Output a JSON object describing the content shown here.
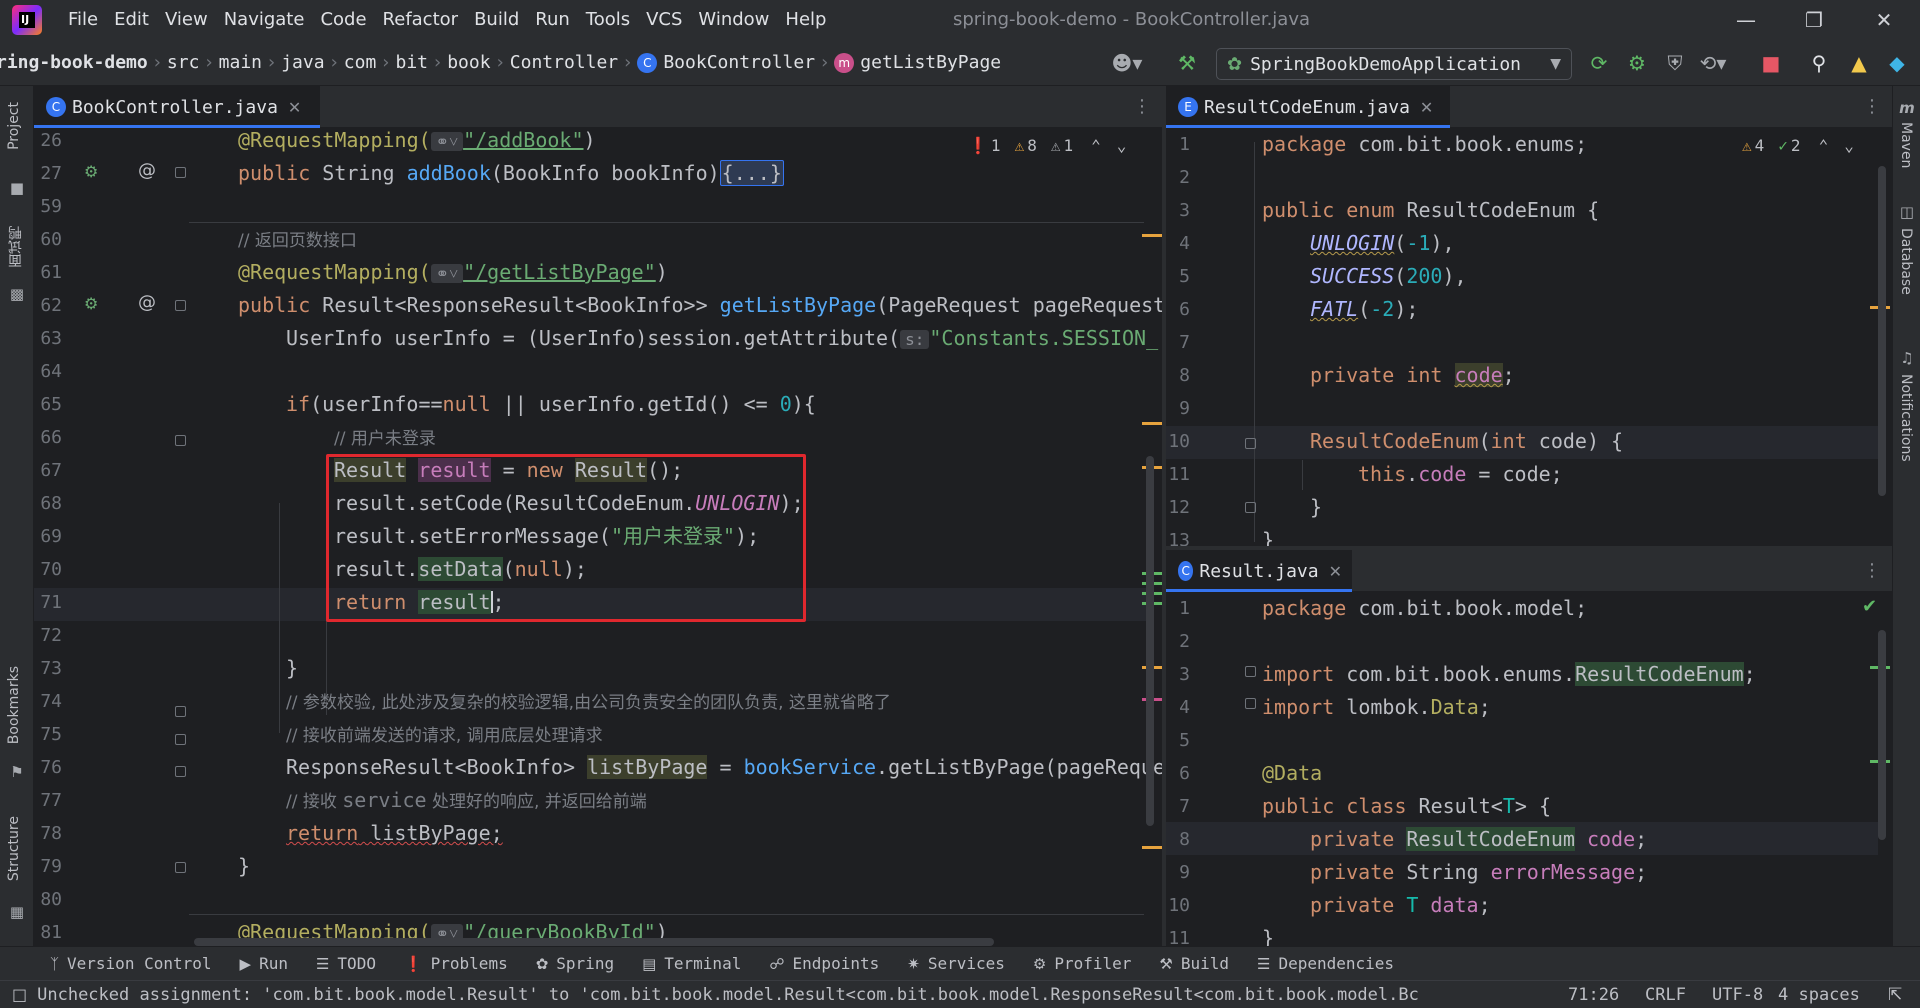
{
  "menubar": {
    "items": [
      "File",
      "Edit",
      "View",
      "Navigate",
      "Code",
      "Refactor",
      "Build",
      "Run",
      "Tools",
      "VCS",
      "Window",
      "Help"
    ],
    "window_title": "spring-book-demo - BookController.java"
  },
  "navbar": {
    "crumbs": [
      "ring-book-demo",
      "src",
      "main",
      "java",
      "com",
      "bit",
      "book",
      "Controller",
      "BookController",
      "getListByPage"
    ],
    "run_config": "SpringBookDemoApplication"
  },
  "left_stripe": {
    "project_label": "Project",
    "favorites_label": "面试鸭",
    "bookmarks_label": "Bookmarks",
    "structure_label": "Structure"
  },
  "right_stripe": {
    "maven_label": "Maven",
    "database_label": "Database",
    "notifications_label": "Notifications"
  },
  "left_editor": {
    "tab": "BookController.java",
    "inspections": {
      "errors": "1",
      "warnings": "8",
      "weak_warnings": "1"
    },
    "line_numbers": [
      "26",
      "27",
      "59",
      "60",
      "61",
      "62",
      "63",
      "64",
      "65",
      "66",
      "67",
      "68",
      "69",
      "70",
      "71",
      "72",
      "73",
      "74",
      "75",
      "76",
      "77",
      "78",
      "79",
      "80",
      "81"
    ],
    "lines": {
      "l26_ann": "@RequestMapping(",
      "l26_path": "\"/addBook\"",
      "l26_end": ")",
      "l27_pub": "public ",
      "l27_type": "String ",
      "l27_fn": "addBook",
      "l27_args": "(BookInfo bookInfo)",
      "l27_fold": "{...}",
      "l60": "// 返回页数接口",
      "l61_ann": "@RequestMapping(",
      "l61_path": "\"/getListByPage\"",
      "l61_end": ")",
      "l62_pub": "public ",
      "l62_type": "Result<ResponseResult<BookInfo>> ",
      "l62_fn": "getListByPage",
      "l62_args": "(PageRequest pageRequest",
      "l63_a": "UserInfo userInfo = (UserInfo)session.getAttribute(",
      "l63_hint": "s:",
      "l63_str": "\"Constants.SESSION_",
      "l65_if": "if",
      "l65_a": "(userInfo==",
      "l65_null": "null",
      "l65_b": " || userInfo.getId() <= ",
      "l65_num": "0",
      "l65_c": "){",
      "l66": "// 用户未登录",
      "l67_t1": "Result",
      "l67_v": "result",
      "l67_eq": " = ",
      "l67_new": "new ",
      "l67_t2": "Result",
      "l67_end": "();",
      "l68_a": "result.setCode(ResultCodeEnum.",
      "l68_const": "UNLOGIN",
      "l68_end": ");",
      "l69_a": "result.setErrorMessage(",
      "l69_str": "\"用户未登录\"",
      "l69_end": ");",
      "l70_a": "result.",
      "l70_fn": "setData",
      "l70_b": "(",
      "l70_null": "null",
      "l70_end": ");",
      "l71_ret": "return ",
      "l71_v": "result",
      "l71_end": ";",
      "l73": "}",
      "l74": "// 参数校验, 此处涉及复杂的校验逻辑,由公司负责安全的团队负责, 这里就省略了",
      "l75": "// 接收前端发送的请求, 调用底层处理请求",
      "l76_a": "ResponseResult<BookInfo> ",
      "l76_v": "listByPage",
      "l76_eq": " = ",
      "l76_svc": "bookService",
      "l76_b": ".getListByPage(pageReque",
      "l77_a": "// 接收 ",
      "l77_b": "service",
      "l77_c": " 处理好的响应, 并返回给前端",
      "l78_ret": "return",
      "l78_b": " listByPage;",
      "l79": "}",
      "l81_ann": "@RequestMapping(",
      "l81_path": "\"/queryBookById\"",
      "l81_end": ")"
    }
  },
  "right_top_editor": {
    "tab": "ResultCodeEnum.java",
    "inspections": {
      "warnings": "4",
      "typos": "2"
    },
    "line_numbers": [
      "1",
      "2",
      "3",
      "4",
      "5",
      "6",
      "7",
      "8",
      "9",
      "10",
      "11",
      "12",
      "13"
    ],
    "lines": {
      "l1_kw": "package ",
      "l1_b": "com.bit.book.enums;",
      "l3_kw": "public enum ",
      "l3_b": "ResultCodeEnum {",
      "l4_c": "UNLOGIN",
      "l4_a": "(",
      "l4_n": "-1",
      "l4_e": "),",
      "l5_c": "SUCCESS",
      "l5_a": "(",
      "l5_n": "200",
      "l5_e": "),",
      "l6_c": "FATL",
      "l6_a": "(",
      "l6_n": "-2",
      "l6_e": ");",
      "l8_kw": "private int ",
      "l8_f": "code",
      "l8_e": ";",
      "l10_fn": "ResultCodeEnum",
      "l10_a": "(",
      "l10_kw": "int ",
      "l10_b": "code) {",
      "l11_kw": "this",
      "l11_a": ".",
      "l11_f": "code",
      "l11_b": " = code;",
      "l12": "}",
      "l13": "}"
    }
  },
  "right_bottom_editor": {
    "tab": "Result.java",
    "line_numbers": [
      "1",
      "2",
      "3",
      "4",
      "5",
      "6",
      "7",
      "8",
      "9",
      "10",
      "11"
    ],
    "lines": {
      "l1_kw": "package ",
      "l1_b": "com.bit.book.model;",
      "l3_kw": "import ",
      "l3_b": "com.bit.book.enums.",
      "l3_c": "ResultCodeEnum",
      "l3_e": ";",
      "l4_kw": "import ",
      "l4_b": "lombok.",
      "l4_c": "Data",
      "l4_e": ";",
      "l6": "@Data",
      "l7_kw": "public class ",
      "l7_b": "Result<",
      "l7_t": "T",
      "l7_e": "> {",
      "l8_kw": "private ",
      "l8_t": "ResultCodeEnum",
      "l8_f": " code",
      "l8_e": ";",
      "l9_kw": "private ",
      "l9_t": "String ",
      "l9_f": "errorMessage",
      "l9_e": ";",
      "l10_kw": "private ",
      "l10_t": "T ",
      "l10_f": "data",
      "l10_e": ";",
      "l11": "}"
    }
  },
  "toolwindows": [
    "Version Control",
    "Run",
    "TODO",
    "Problems",
    "Spring",
    "Terminal",
    "Endpoints",
    "Services",
    "Profiler",
    "Build",
    "Dependencies"
  ],
  "statusbar": {
    "message": "Unchecked assignment: 'com.bit.book.model.Result' to 'com.bit.book.model.Result<com.bit.book.model.ResponseResult<com.bit.book.model.Bc",
    "position": "71:26",
    "line_sep": "CRLF",
    "encoding": "UTF-8",
    "indent": "4 spaces"
  },
  "colors": {
    "accent": "#3574f0",
    "highlight_box": "#e0282e",
    "error": "#e55765",
    "warning": "#e6a33e"
  }
}
